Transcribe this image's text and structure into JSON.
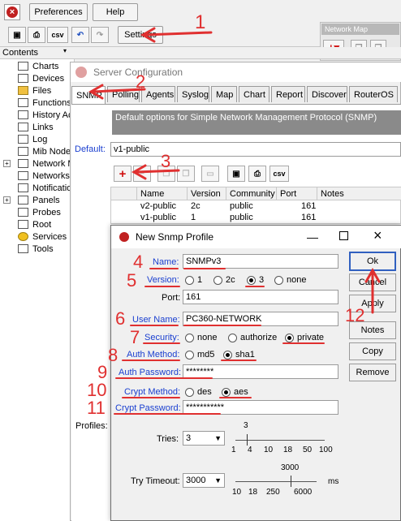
{
  "toolbar": {
    "preferences": "Preferences",
    "help": "Help",
    "settings": "Settings",
    "csv": "csv",
    "network_map": "Network Map"
  },
  "sidebar": {
    "header": "Contents",
    "items": [
      {
        "label": "Charts"
      },
      {
        "label": "Devices"
      },
      {
        "label": "Files"
      },
      {
        "label": "Functions"
      },
      {
        "label": "History Actions"
      },
      {
        "label": "Links"
      },
      {
        "label": "Log"
      },
      {
        "label": "Mib Nodes"
      },
      {
        "label": "Network Maps"
      },
      {
        "label": "Networks"
      },
      {
        "label": "Notifications"
      },
      {
        "label": "Panels"
      },
      {
        "label": "Probes"
      },
      {
        "label": "Root"
      },
      {
        "label": "Services"
      },
      {
        "label": "Tools"
      }
    ]
  },
  "server_config": {
    "title": "Server Configuration",
    "tabs": [
      "SNMP",
      "Polling",
      "Agents",
      "Syslog",
      "Map",
      "Chart",
      "Report",
      "Discover",
      "RouterOS"
    ],
    "description": "Default options for Simple Network Management Protocol (SNMP)",
    "default_label": "Default:",
    "default_value": "v1-public",
    "csv": "csv",
    "profiles_label": "Profiles:",
    "columns": [
      "Name",
      "Version",
      "Community",
      "Port",
      "Notes"
    ],
    "rows": [
      {
        "name": "v2-public",
        "version": "2c",
        "community": "public",
        "port": "161"
      },
      {
        "name": "v1-public",
        "version": "1",
        "community": "public",
        "port": "161"
      }
    ]
  },
  "dialog": {
    "title": "New Snmp Profile",
    "name_label": "Name:",
    "name_value": "SNMPv3",
    "version_label": "Version:",
    "version_options": [
      "1",
      "2c",
      "3",
      "none"
    ],
    "version_selected": "3",
    "port_label": "Port:",
    "port_value": "161",
    "username_label": "User Name:",
    "username_value": "PC360-NETWORK",
    "security_label": "Security:",
    "security_options": [
      "none",
      "authorize",
      "private"
    ],
    "security_selected": "private",
    "auth_method_label": "Auth Method:",
    "auth_method_options": [
      "md5",
      "sha1"
    ],
    "auth_method_selected": "sha1",
    "auth_password_label": "Auth Password:",
    "auth_password_value": "********",
    "crypt_method_label": "Crypt Method:",
    "crypt_method_options": [
      "des",
      "aes"
    ],
    "crypt_method_selected": "aes",
    "crypt_password_label": "Crypt Password:",
    "crypt_password_value": "***********",
    "tries_label": "Tries:",
    "tries_value": "3",
    "tries_slider_value": "3",
    "tries_ticks": [
      "1",
      "4",
      "10",
      "18",
      "50",
      "100"
    ],
    "timeout_label": "Try Timeout:",
    "timeout_value": "3000",
    "timeout_slider_value": "3000",
    "timeout_ticks": [
      "10",
      "18",
      "250",
      "6000"
    ],
    "timeout_unit": "ms",
    "buttons": {
      "ok": "Ok",
      "cancel": "Cancel",
      "apply": "Apply",
      "notes": "Notes",
      "copy": "Copy",
      "remove": "Remove"
    }
  },
  "annotations": [
    "1",
    "2",
    "3",
    "4",
    "5",
    "6",
    "7",
    "8",
    "9",
    "10",
    "11",
    "12"
  ],
  "colors": {
    "annotation": "#e03030",
    "link_label": "#1a3fd0",
    "plus_red": "#d01010"
  }
}
